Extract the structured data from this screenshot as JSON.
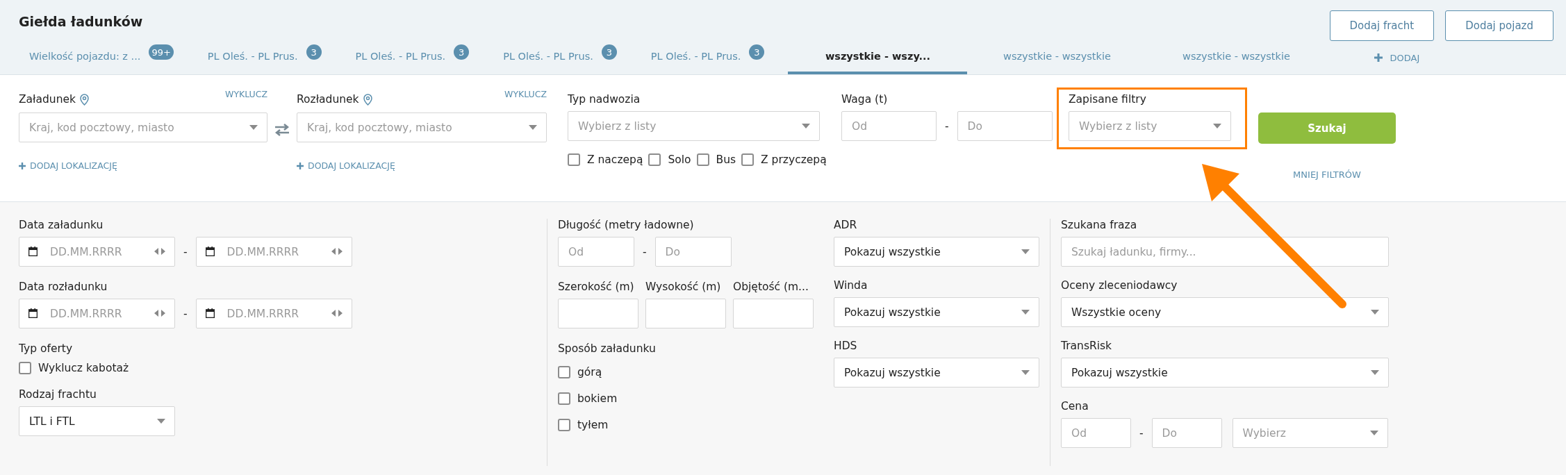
{
  "page": {
    "title": "Giełda ładunków"
  },
  "header_buttons": [
    "Dodaj fracht",
    "Dodaj pojazd"
  ],
  "tabs": [
    {
      "label": "Wielkość pojazdu: z ...",
      "badge": "99+",
      "selected": false
    },
    {
      "label": "PL Oleś. - PL Prus.",
      "badge": "3",
      "selected": false
    },
    {
      "label": "PL Oleś. - PL Prus.",
      "badge": "3",
      "selected": false
    },
    {
      "label": "PL Oleś. - PL Prus.",
      "badge": "3",
      "selected": false
    },
    {
      "label": "PL Oleś. - PL Prus.",
      "badge": "3",
      "selected": false
    },
    {
      "label": "wszystkie - wszy...",
      "selected": true
    },
    {
      "label": "wszystkie - wszystkie",
      "selected": false
    },
    {
      "label": "wszystkie - wszystkie",
      "selected": false
    }
  ],
  "add_tab": {
    "label": "DODAJ"
  },
  "filters": {
    "locations": [
      {
        "label": "Załadunek",
        "exclude": "WYKLUCZ",
        "placeholder": "Kraj, kod pocztowy, miasto",
        "add_location": "DODAJ LOKALIZACJĘ"
      },
      {
        "label": "Rozładunek",
        "exclude": "WYKLUCZ",
        "placeholder": "Kraj, kod pocztowy, miasto",
        "add_location": "DODAJ LOKALIZACJĘ"
      }
    ],
    "body_type": {
      "label": "Typ nadwozia",
      "placeholder": "Wybierz z listy",
      "options": [
        {
          "label": "Z naczepą",
          "checked": false
        },
        {
          "label": "Solo",
          "checked": false
        },
        {
          "label": "Bus",
          "checked": false
        },
        {
          "label": "Z przyczepą",
          "checked": false
        }
      ]
    },
    "weight": {
      "label": "Waga (t)",
      "from_placeholder": "Od",
      "separator": "-",
      "to_placeholder": "Do"
    },
    "saved_filters": {
      "label": "Zapisane filtry",
      "placeholder": "Wybierz z listy",
      "highlighted": true
    },
    "search_button": "Szukaj",
    "less_filters": "MNIEJ FILTRÓW"
  },
  "advanced": {
    "columns": [
      [
        {
          "kind": "date_range",
          "label": "Data załadunku",
          "from_placeholder": "DD.MM.RRRR",
          "separator": "-",
          "to_placeholder": "DD.MM.RRRR"
        },
        {
          "kind": "date_range",
          "label": "Data rozładunku",
          "from_placeholder": "DD.MM.RRRR",
          "separator": "-",
          "to_placeholder": "DD.MM.RRRR"
        },
        {
          "kind": "checkboxes",
          "label": "Typ oferty",
          "options": [
            {
              "label": "Wyklucz kabotaż",
              "checked": false
            }
          ]
        },
        {
          "kind": "select",
          "label": "Rodzaj frachtu",
          "value": "LTL i FTL"
        }
      ],
      [
        {
          "kind": "range",
          "label": "Długość (metry ładowne)",
          "from_placeholder": "Od",
          "separator": "-",
          "to_placeholder": "Do"
        },
        {
          "kind": "inputs_row",
          "fields": [
            {
              "label": "Szerokość (m)"
            },
            {
              "label": "Wysokość (m)"
            },
            {
              "label": "Objętość (m..."
            }
          ]
        },
        {
          "kind": "checkboxes",
          "label": "Sposób załadunku",
          "options": [
            {
              "label": "górą",
              "checked": false
            },
            {
              "label": "bokiem",
              "checked": false
            },
            {
              "label": "tyłem",
              "checked": false
            }
          ]
        }
      ],
      [
        {
          "kind": "select",
          "label": "ADR",
          "value": "Pokazuj wszystkie"
        },
        {
          "kind": "select",
          "label": "Winda",
          "value": "Pokazuj wszystkie"
        },
        {
          "kind": "select",
          "label": "HDS",
          "value": "Pokazuj wszystkie"
        }
      ],
      [
        {
          "kind": "text",
          "label": "Szukana fraza",
          "placeholder": "Szukaj ładunku, firmy..."
        },
        {
          "kind": "select",
          "label": "Oceny zleceniodawcy",
          "value": "Wszystkie oceny"
        },
        {
          "kind": "select",
          "label": "TransRisk",
          "value": "Pokazuj wszystkie"
        },
        {
          "kind": "price",
          "label": "Cena",
          "from_placeholder": "Od",
          "separator": "-",
          "to_placeholder": "Do",
          "currency_placeholder": "Wybierz"
        }
      ]
    ]
  }
}
